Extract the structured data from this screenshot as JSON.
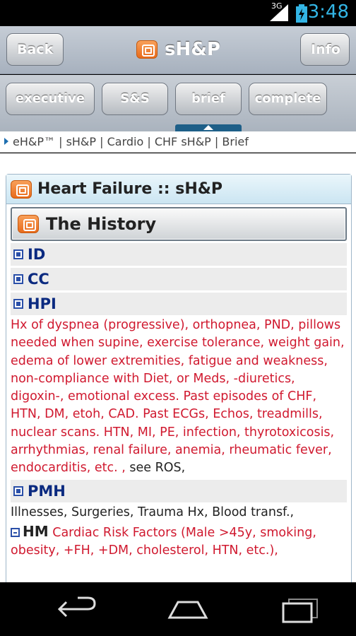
{
  "status": {
    "time": "3:48",
    "network": "3G",
    "icons": [
      "signal-icon",
      "battery-charging-icon"
    ]
  },
  "header": {
    "back_label": "Back",
    "title": "sH&P",
    "info_label": "Info",
    "logo_icon": "app-logo-icon"
  },
  "tabs": [
    {
      "label": "executive"
    },
    {
      "label": "S&S"
    },
    {
      "label": "brief",
      "active": true
    },
    {
      "label": "complete"
    }
  ],
  "breadcrumb": "eH&P™ | sH&P | Cardio | CHF sH&P | Brief",
  "panel": {
    "title": "Heart Failure :: sH&P",
    "section_title": "The History"
  },
  "sections": {
    "id": "ID",
    "cc": "CC",
    "hpi": "HPI",
    "hpi_text": "Hx of dyspnea (progressive), orthopnea, PND, pillows needed when supine, exercise tolerance, weight gain, edema of lower extremities, fatigue and weakness, non-compliance with Diet, or Meds, -diuretics, digoxin-, emotional excess. Past episodes of CHF, HTN, DM, etoh, CAD. Past ECGs, Echos, treadmills, nuclear scans. HTN, MI, PE, infection, thyrotoxicosis, arrhythmias, renal failure, anemia, rheumatic fever, endocarditis, etc. ,",
    "hpi_see": "see",
    "hpi_ros": "ROS,",
    "pmh": "PMH",
    "pmh_text": "Illnesses, Surgeries, Trauma Hx, Blood transf.,",
    "hm": "HM",
    "hm_text": "Cardiac Risk Factors (Male >45y, smoking, obesity, +FH, +DM, cholesterol, HTN, etc.),"
  },
  "colors": {
    "accent": "#1e5f88",
    "section_text": "#0b2a80",
    "body_red": "#d0192f",
    "status_blue": "#33b5e5"
  }
}
